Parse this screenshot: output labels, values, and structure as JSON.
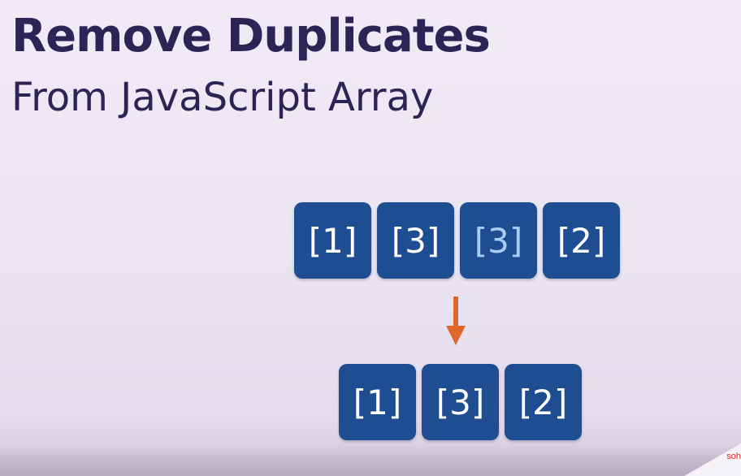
{
  "header": {
    "title": "Remove Duplicates",
    "subtitle": "From JavaScript Array"
  },
  "diagram": {
    "input": [
      {
        "label": "[1]",
        "duplicate": false
      },
      {
        "label": "[3]",
        "duplicate": false
      },
      {
        "label": "[3]",
        "duplicate": true
      },
      {
        "label": "[2]",
        "duplicate": false
      }
    ],
    "output": [
      {
        "label": "[1]"
      },
      {
        "label": "[3]"
      },
      {
        "label": "[2]"
      }
    ],
    "arrow_icon": "arrow-down-icon"
  },
  "watermark": "soh",
  "colors": {
    "title": "#2d2456",
    "cell_bg": "#1e4d92",
    "cell_text": "#ffffff",
    "duplicate_text": "#a7cdf2",
    "arrow": "#e0672c",
    "watermark": "#e0312c"
  }
}
